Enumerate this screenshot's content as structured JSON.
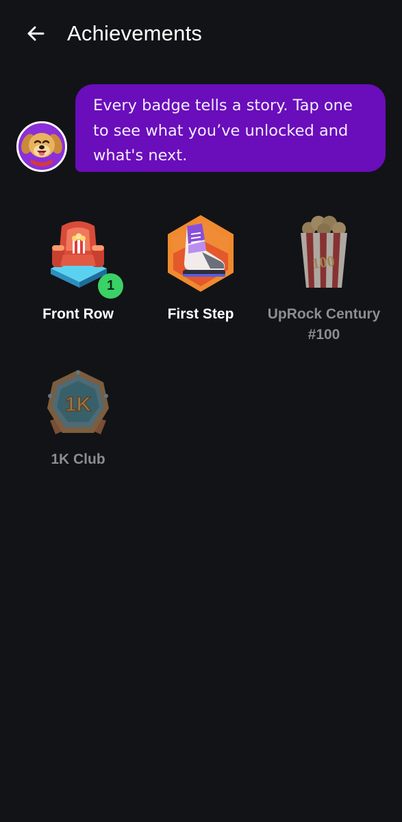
{
  "header": {
    "title": "Achievements",
    "back_icon": "arrow-left-icon"
  },
  "mascot": {
    "avatar_icon": "dog-mascot-avatar",
    "message": "Every badge tells a story. Tap one to see what you’ve unlocked and what's next."
  },
  "badges": [
    {
      "label": "Front Row",
      "icon": "cinema-seat-popcorn-icon",
      "state": "unlocked",
      "count": "1"
    },
    {
      "label": "First Step",
      "icon": "sneaker-hexagon-icon",
      "state": "unlocked"
    },
    {
      "label": "UpRock Century #100",
      "icon": "popcorn-bucket-100-icon",
      "state": "locked"
    },
    {
      "label": "1K Club",
      "icon": "1k-medal-icon",
      "state": "locked"
    }
  ],
  "colors": {
    "background": "#121316",
    "bubble": "#6a0dbb",
    "count_badge": "#3ad166",
    "locked_label": "#8c8d92"
  }
}
